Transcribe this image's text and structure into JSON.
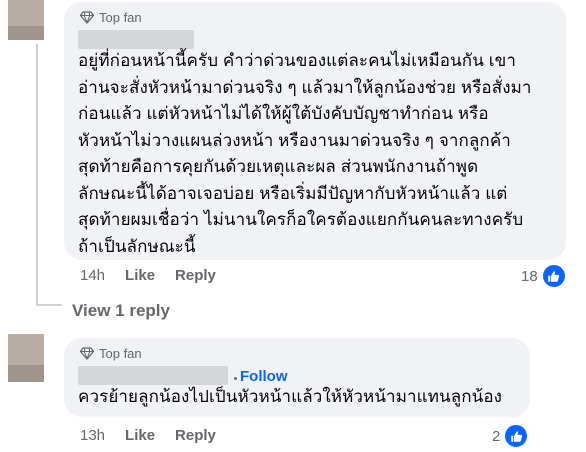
{
  "comments": [
    {
      "badge": "Top fan",
      "text_lines": [
        "อยู่ที่ก่อนหน้านี้ครับ คำว่าด่วนของแต่ละคนไม่เหมือนกัน เขา",
        "อ่านจะสั่งหัวหน้ามาด่วนจริง ๆ แล้วมาให้ลูกน้องช่วย หรือสั่งมา",
        "ก่อนแล้ว แต่หัวหน้าไม่ได้ให้ผู้ใต้บังคับบัญชาทำก่อน หรือ",
        "หัวหน้าไม่วางแผนล่วงหน้า หรืองานมาด่วนจริง ๆ จากลูกค้า",
        "สุดท้ายคือการคุยกันด้วยเหตุและผล ส่วนพนักงานถ้าพูด",
        "ลักษณะนี้ได้อาจเจอบ่อย หรือเริ่มมีปัญหากับหัวหน้าแล้ว แต่",
        "สุดท้ายผมเชื่อว่า ไม่นานใครก็อใครต้องแยกกันคนละทางครับ",
        "ถ้าเป็นลักษณะนี้"
      ],
      "time": "14h",
      "like_label": "Like",
      "reply_label": "Reply",
      "reaction_count": "18"
    },
    {
      "badge": "Top fan",
      "follow_label": "Follow",
      "text_lines": [
        "ควรย้ายลูกน้องไปเป็นหัวหน้าแล้วให้หัวหน้ามาแทนลูกน้อง"
      ],
      "time": "13h",
      "like_label": "Like",
      "reply_label": "Reply",
      "reaction_count": "2"
    }
  ],
  "view_replies_label": "View 1 reply",
  "icons": {
    "badge": "diamond-badge-icon",
    "reaction": "thumbs-up-icon"
  },
  "colors": {
    "link": "#0866ff",
    "secondary_text": "#65676b",
    "bubble": "#f0f2f5"
  }
}
